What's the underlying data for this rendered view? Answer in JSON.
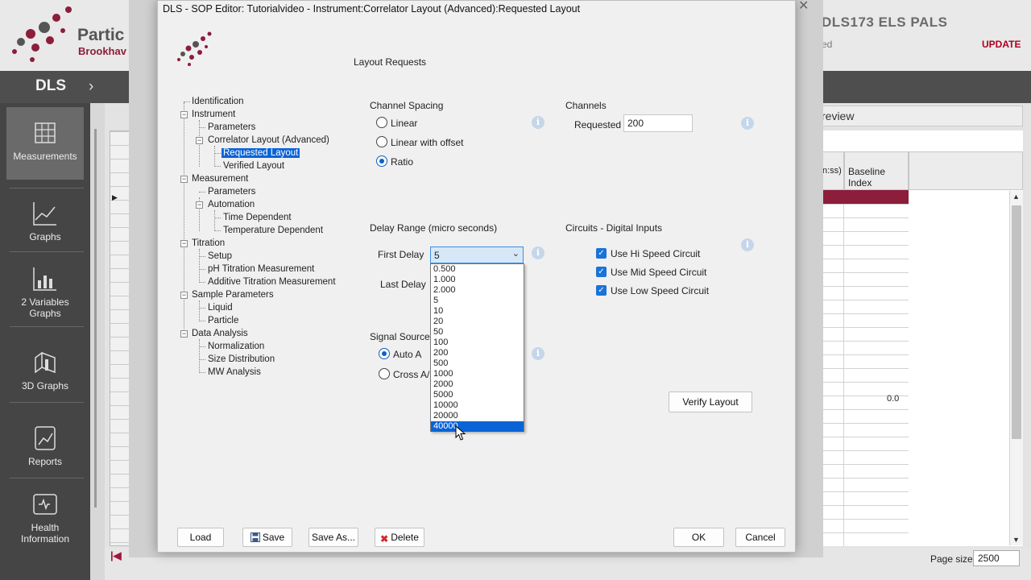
{
  "background_app": {
    "brand": "Partic",
    "brand_sub": "Brookhav",
    "right_title": "DLS173  ELS  PALS",
    "right_sub": "ed",
    "update": "UPDATE",
    "nav_title": "DLS",
    "sidebar": [
      {
        "label": "Measurements",
        "icon": "grid-icon"
      },
      {
        "label": "Graphs",
        "icon": "line-graph-icon"
      },
      {
        "label": "2 Variables\nGraphs",
        "icon": "bar-graph-icon"
      },
      {
        "label": "3D Graphs",
        "icon": "3d-graph-icon"
      },
      {
        "label": "Reports",
        "icon": "reports-icon"
      },
      {
        "label": "Health\nInformation",
        "icon": "health-icon"
      }
    ],
    "preview_label": "review",
    "col_head1": "n:ss)",
    "col_head2": "Baseline Index",
    "baseline_value": "0.0",
    "page_size_label": "Page size:",
    "page_size_value": "2500"
  },
  "dialog": {
    "title": "DLS - SOP Editor: Tutorialvideo - Instrument:Correlator Layout (Advanced):Requested Layout",
    "section_title": "Layout Requests",
    "tree": [
      {
        "label": "Identification"
      },
      {
        "label": "Instrument"
      },
      {
        "label": "Parameters"
      },
      {
        "label": "Correlator Layout (Advanced)"
      },
      {
        "label": "Requested Layout",
        "selected": true
      },
      {
        "label": "Verified Layout"
      },
      {
        "label": "Measurement"
      },
      {
        "label": "Parameters"
      },
      {
        "label": "Automation"
      },
      {
        "label": "Time Dependent"
      },
      {
        "label": "Temperature Dependent"
      },
      {
        "label": "Titration"
      },
      {
        "label": "Setup"
      },
      {
        "label": "pH Titration Measurement"
      },
      {
        "label": "Additive Titration Measurement"
      },
      {
        "label": "Sample Parameters"
      },
      {
        "label": "Liquid"
      },
      {
        "label": "Particle"
      },
      {
        "label": "Data Analysis"
      },
      {
        "label": "Normalization"
      },
      {
        "label": "Size Distribution"
      },
      {
        "label": "MW Analysis"
      }
    ],
    "channel_spacing": {
      "title": "Channel Spacing",
      "options": [
        "Linear",
        "Linear with offset",
        "Ratio"
      ],
      "selected": "Ratio"
    },
    "channels": {
      "title": "Channels",
      "requested_label": "Requested",
      "requested_value": "200"
    },
    "delay_range": {
      "title": "Delay Range (micro seconds)",
      "first_delay_label": "First Delay",
      "first_delay_value": "5",
      "last_delay_label": "Last Delay",
      "dropdown_options": [
        "0.500",
        "1.000",
        "2.000",
        "5",
        "10",
        "20",
        "50",
        "100",
        "200",
        "500",
        "1000",
        "2000",
        "5000",
        "10000",
        "20000",
        "40000"
      ],
      "highlighted_option": "40000"
    },
    "circuits": {
      "title": "Circuits - Digital Inputs",
      "items": [
        {
          "label": "Use Hi Speed Circuit",
          "checked": true
        },
        {
          "label": "Use Mid Speed Circuit",
          "checked": true
        },
        {
          "label": "Use Low Speed Circuit",
          "checked": true
        }
      ]
    },
    "signal_source": {
      "title": "Signal Source",
      "options": [
        "Auto A",
        "Cross A/B"
      ],
      "selected": "Auto A"
    },
    "buttons": {
      "verify_layout": "Verify Layout",
      "load": "Load",
      "save": "Save",
      "save_as": "Save As...",
      "delete": "Delete",
      "ok": "OK",
      "cancel": "Cancel"
    },
    "colors": {
      "accent": "#0a64d6",
      "brand": "#8c1d3b"
    }
  }
}
